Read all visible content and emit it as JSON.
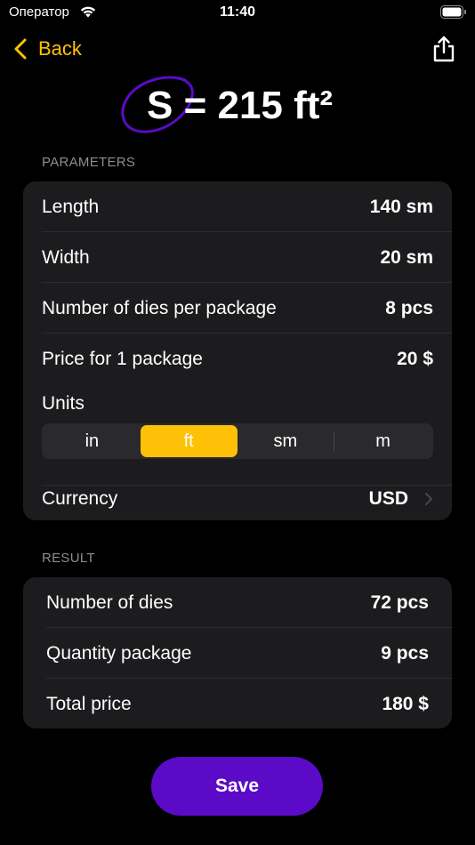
{
  "status_bar": {
    "carrier": "Оператор",
    "time": "11:40"
  },
  "nav": {
    "back_label": "Back",
    "accent_color": "#FFC107"
  },
  "title": {
    "text": "S = 215 ft²",
    "circle_color": "#5b0bc7"
  },
  "parameters": {
    "header": "PARAMETERS",
    "rows": [
      {
        "label": "Length",
        "value": "140 sm"
      },
      {
        "label": "Width",
        "value": "20 sm"
      },
      {
        "label": "Number of dies per package",
        "value": "8 pcs"
      },
      {
        "label": "Price for 1 package",
        "value": "20 $"
      }
    ],
    "units": {
      "label": "Units",
      "options": [
        "in",
        "ft",
        "sm",
        "m"
      ],
      "selected": "ft"
    },
    "currency": {
      "label": "Currency",
      "value": "USD"
    }
  },
  "result": {
    "header": "RESULT",
    "rows": [
      {
        "label": "Number of dies",
        "value": "72 pcs"
      },
      {
        "label": "Quantity package",
        "value": "9 pcs"
      },
      {
        "label": "Total price",
        "value": "180 $"
      }
    ]
  },
  "save_button": {
    "label": "Save",
    "color": "#5b0bc7"
  }
}
